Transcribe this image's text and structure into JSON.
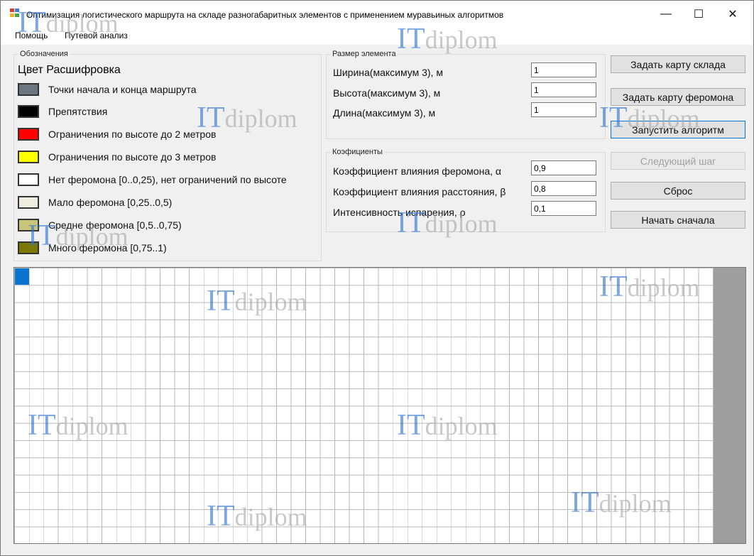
{
  "window": {
    "title": "Оптимизация логистического маршрута на складе разногабаритных элементов с применением муравьиных алгоритмов",
    "controls": {
      "minimize": "—",
      "maximize": "☐",
      "close": "✕"
    }
  },
  "menu": [
    "Помощь",
    "Путевой анализ"
  ],
  "legend": {
    "title": "Обозначения",
    "header": "Цвет Расшифровка",
    "items": [
      {
        "label": "Точки начала и конца маршрута",
        "color": "#6b7680"
      },
      {
        "label": "Препятствия",
        "color": "#000000"
      },
      {
        "label": "Ограничения по высоте до 2 метров",
        "color": "#ff0000"
      },
      {
        "label": "Ограничения по высоте до 3 метров",
        "color": "#ffff00"
      },
      {
        "label": "Нет феромона [0..0,25), нет ограничений по высоте",
        "color": "#ffffff"
      },
      {
        "label": "Мало феромона [0,25..0,5)",
        "color": "#eeeee0"
      },
      {
        "label": "Средне феромона [0,5..0,75)",
        "color": "#c8c47a"
      },
      {
        "label": "Много феромона [0,75..1)",
        "color": "#7c7800"
      }
    ]
  },
  "size_group": {
    "title": "Размер элемента",
    "fields": [
      {
        "label": "Ширина(максимум 3), м",
        "value": "1"
      },
      {
        "label": "Высота(максимум 3), м",
        "value": "1"
      },
      {
        "label": "Длина(максимум 3), м",
        "value": "1"
      }
    ]
  },
  "coef_group": {
    "title": "Коэфициенты",
    "fields": [
      {
        "label": "Коэффициент влияния феромона, α",
        "value": "0,9"
      },
      {
        "label": "Коэффициент влияния расстояния, β",
        "value": "0,8"
      },
      {
        "label": "Интенсивность испарения, ρ",
        "value": "0,1"
      }
    ]
  },
  "buttons": {
    "set_warehouse_map": "Задать карту склада",
    "set_pheromone_map": "Задать карту феромона",
    "run_algorithm": "Запустить алгоритм",
    "next_step": "Следующий шаг",
    "reset": "Сброс",
    "restart": "Начать сначала"
  },
  "watermark": {
    "prefix": "IT",
    "suffix": "diplom"
  },
  "colors": {
    "start_cell": "#0a74d1",
    "accent": "#0078d7"
  }
}
